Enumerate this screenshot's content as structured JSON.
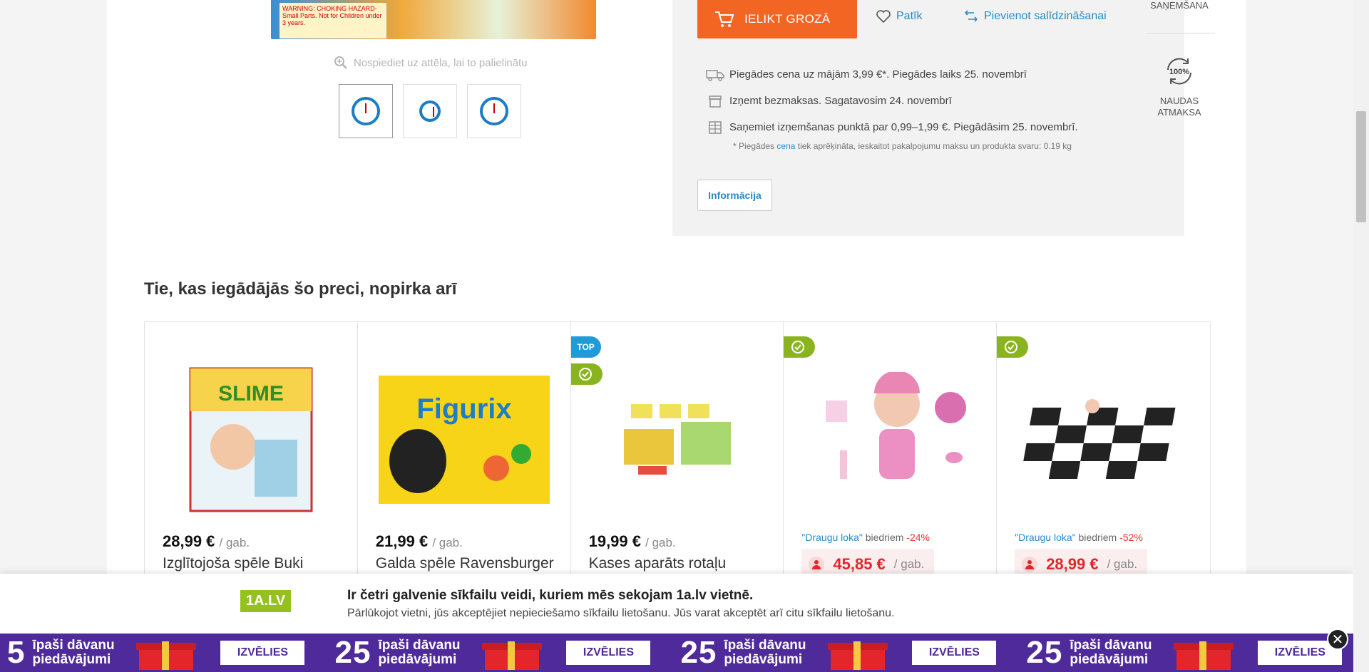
{
  "gallery": {
    "warning_text": "WARNING: CHOKING HAZARD-Small Parts. Not for Children under 3 years.",
    "zoom_hint": "Nospiediet uz attēla, lai to palielinātu"
  },
  "buy_box": {
    "cart_button": "IELIKT GROZĀ",
    "like_label": "Patīk",
    "compare_label": "Pievienot salīdzināšanai",
    "delivery": [
      {
        "icon": "truck-icon",
        "text": "Piegādes cena uz mājām 3,99 €*. Piegādes laiks 25. novembrī"
      },
      {
        "icon": "store-box-icon",
        "text": "Izņemt bezmaksas. Sagatavosim 24. novembrī"
      },
      {
        "icon": "parcel-locker-icon",
        "text": "Saņemiet izņemšanas punktā par 0,99–1,99 €. Piegādāsim 25. novembrī."
      }
    ],
    "note_prefix": "* Piegādes ",
    "note_link": "cena",
    "note_suffix": " tiek aprēķināta, ieskaitot pakalpojumu maksu un produkta svaru: 0.19 kg",
    "info_button": "Informācija"
  },
  "side": {
    "top_label": "SAŅEMŠANA",
    "money_back_badge": "100%",
    "money_back_label_1": "NAUDAS",
    "money_back_label_2": "ATMAKSA"
  },
  "related": {
    "title": "Tie, kas iegādājās šo preci, nopirka arī",
    "products": [
      {
        "price": "28,99 €",
        "unit": "/ gab.",
        "name": "Izglītojoša spēle Buki"
      },
      {
        "price": "21,99 €",
        "unit": "/ gab.",
        "name": "Galda spēle Ravensburger"
      },
      {
        "badge_top": "TOP",
        "price": "19,99 €",
        "unit": "/ gab.",
        "name": "Kases aparāts rotaļu"
      },
      {
        "club_link": "\"Draugu loka\"",
        "club_text": " biedriem ",
        "discount": "-24%",
        "price": "45,85 €",
        "unit": "/ gab."
      },
      {
        "club_link": "\"Draugu loka\"",
        "club_text": " biedriem ",
        "discount": "-52%",
        "price": "28,99 €",
        "unit": "/ gab."
      }
    ]
  },
  "cookie": {
    "logo": "1A.LV",
    "title": "Ir četri galvenie sīkfailu veidi, kuriem mēs sekojam 1a.lv vietnē.",
    "text": "Pārlūkojot vietni, jūs akceptējiet nepieciešamo sīkfailu lietošanu. Jūs varat akceptēt arī citu sīkfailu lietošanu."
  },
  "promo": {
    "number": "25",
    "text_1": "īpaši dāvanu",
    "text_2": "piedāvājumi",
    "button": "IZVĒLIES",
    "leading_number": "5",
    "close": "✕"
  },
  "colors": {
    "accent_orange": "#f26522",
    "link_blue": "#2a89c8",
    "promo_purple": "#4f2a9a",
    "brand_green": "#95c11f"
  }
}
